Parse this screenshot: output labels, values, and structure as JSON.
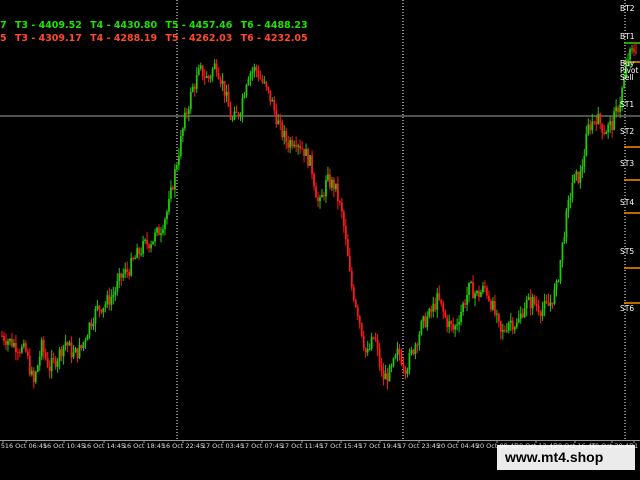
{
  "colors": {
    "background": "#000000",
    "bull": "#22c80a",
    "bear": "#ff1a1a",
    "grid_line": "#ffffff",
    "pivot_line": "#a0a0a0",
    "level_buy": "#22e000",
    "level_sell": "#ff4a2a"
  },
  "levels": {
    "buy": [
      "7",
      "T3 - 4409.52",
      "T4 - 4430.80",
      "T5 - 4457.46",
      "T6 - 4488.23"
    ],
    "sell": [
      "5",
      "T3 - 4309.17",
      "T4 - 4288.19",
      "T5 - 4262.03",
      "T6 - 4232.05"
    ]
  },
  "right_labels": [
    "BT2",
    "BT1",
    "Buy",
    "Pivot",
    "Sell",
    "ST1",
    "ST2",
    "ST3",
    "ST4",
    "ST5",
    "ST6"
  ],
  "watermark": "www.mt4.shop",
  "chart_data": {
    "type": "candlestick",
    "x_tick_labels": [
      "5",
      "16 Oct 06:45",
      "16 Oct 10:45",
      "16 Oct 14:45",
      "16 Oct 18:45",
      "16 Oct 22:45",
      "17 Oct 03:45",
      "17 Oct 07:45",
      "17 Oct 11:45",
      "17 Oct 15:45",
      "17 Oct 19:45",
      "17 Oct 23:45",
      "20 Oct 04:45",
      "20 Oct 08:45",
      "20 Oct 12:45",
      "20 Oct 16:45",
      "20 Oct 20:45",
      "21"
    ],
    "price_levels": {
      "BT2": 4488.23,
      "BT1": 4457.46,
      "Pivot": 4370.0,
      "ST1": 4340.0,
      "ST2": 4309.17,
      "ST3": 4288.19,
      "ST4": 4262.03,
      "ST5": 4232.05,
      "ST6": 4200.0
    },
    "close_path": [
      4200,
      4195,
      4190,
      4185,
      4155,
      4190,
      4170,
      4180,
      4195,
      4182,
      4188,
      4210,
      4225,
      4230,
      4238,
      4255,
      4262,
      4275,
      4285,
      4290,
      4300,
      4320,
      4360,
      4400,
      4430,
      4448,
      4440,
      4455,
      4432,
      4400,
      4410,
      4445,
      4450,
      4435,
      4420,
      4395,
      4380,
      4385,
      4375,
      4360,
      4320,
      4345,
      4340,
      4310,
      4250,
      4220,
      4180,
      4200,
      4160,
      4165,
      4185,
      4170,
      4190,
      4210,
      4220,
      4235,
      4215,
      4205,
      4225,
      4245,
      4238,
      4245,
      4225,
      4200,
      4215,
      4210,
      4230,
      4232,
      4225,
      4228,
      4245,
      4300,
      4345,
      4350,
      4395,
      4405,
      4392,
      4398,
      4420,
      4460,
      4470
    ]
  }
}
